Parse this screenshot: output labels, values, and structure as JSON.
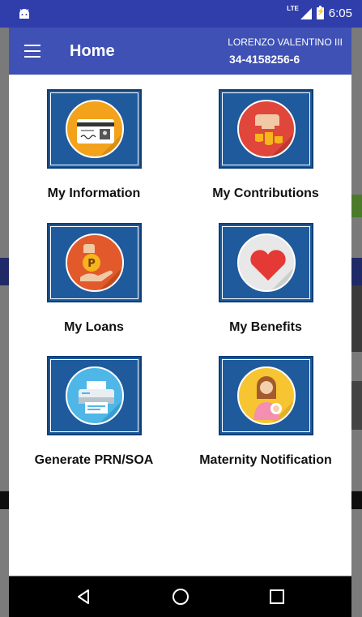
{
  "status_bar": {
    "network": "LTE",
    "time": "6:05",
    "icons": [
      "android-icon",
      "signal-icon",
      "battery-charging-icon"
    ]
  },
  "app_bar": {
    "title": "Home",
    "user_name": "LORENZO VALENTINO III",
    "user_id": "34-4158256-6",
    "menu_icon": "hamburger-menu-icon"
  },
  "tiles": [
    {
      "label": "My Information",
      "icon": "id-card-icon",
      "color": "#f2a31b"
    },
    {
      "label": "My Contributions",
      "icon": "coins-hand-icon",
      "color": "#e0463a"
    },
    {
      "label": "My Loans",
      "icon": "peso-money-bag-icon",
      "color": "#e25a2b"
    },
    {
      "label": "My Benefits",
      "icon": "heart-icon",
      "color": "#e8e8e8"
    },
    {
      "label": "Generate PRN/SOA",
      "icon": "printer-icon",
      "color": "#4fb7e8"
    },
    {
      "label": "Maternity Notification",
      "icon": "mother-baby-icon",
      "color": "#f7c532"
    }
  ],
  "nav_bar": {
    "buttons": [
      "back-icon",
      "home-icon",
      "recents-icon"
    ]
  },
  "colors": {
    "app_bar": "#3f51b5",
    "status_bar": "#2f3eaa",
    "tile_bg": "#1e5a9c"
  }
}
